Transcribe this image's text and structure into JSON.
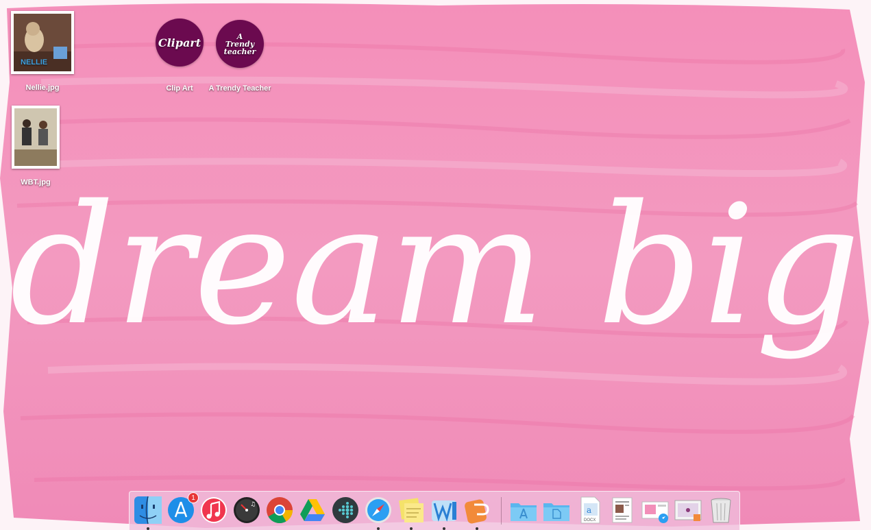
{
  "wallpaper": {
    "text": "dream big",
    "colors": {
      "pink_light": "#f7b4cf",
      "pink_mid": "#ee7eaa",
      "pink_dark": "#e85c97",
      "lettering": "#ffffff"
    }
  },
  "desktop": {
    "files": [
      {
        "label": "Nellie.jpg",
        "photo_text": "NELLIE"
      },
      {
        "label": "WBT.jpg"
      }
    ],
    "folders": [
      {
        "label": "Clip Art",
        "icon_text": "Clipart"
      },
      {
        "label": "A Trendy Teacher",
        "icon_text_lines": [
          "A",
          "Trendy",
          "teacher"
        ]
      }
    ]
  },
  "dock": {
    "apps": [
      {
        "icon": "finder-icon",
        "running": true
      },
      {
        "icon": "app-store-icon",
        "running": false,
        "badge": "1"
      },
      {
        "icon": "itunes-icon",
        "running": false
      },
      {
        "icon": "dashboard-icon",
        "running": false
      },
      {
        "icon": "chrome-icon",
        "running": false
      },
      {
        "icon": "google-drive-icon",
        "running": false
      },
      {
        "icon": "fitbit-icon",
        "running": false
      },
      {
        "icon": "safari-icon",
        "running": true
      },
      {
        "icon": "stickies-icon",
        "running": true
      },
      {
        "icon": "word-icon",
        "running": true
      },
      {
        "icon": "powerpoint-icon",
        "running": true
      }
    ],
    "stacks": [
      {
        "icon": "applications-folder-icon"
      },
      {
        "icon": "documents-folder-icon"
      },
      {
        "icon": "docx-document-icon",
        "label": "DOCX"
      },
      {
        "icon": "document-preview-icon"
      },
      {
        "icon": "safari-download-icon"
      },
      {
        "icon": "screenshot-preview-icon"
      },
      {
        "icon": "trash-icon"
      }
    ]
  }
}
